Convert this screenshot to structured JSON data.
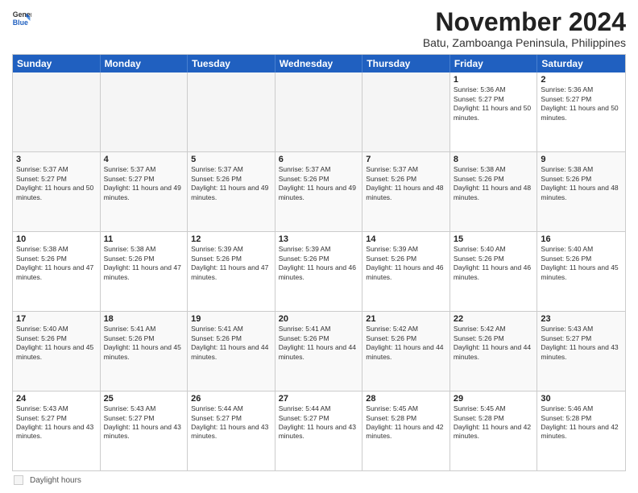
{
  "logo": {
    "general": "General",
    "blue": "Blue"
  },
  "header": {
    "month": "November 2024",
    "location": "Batu, Zamboanga Peninsula, Philippines"
  },
  "days_of_week": [
    "Sunday",
    "Monday",
    "Tuesday",
    "Wednesday",
    "Thursday",
    "Friday",
    "Saturday"
  ],
  "weeks": [
    [
      {
        "day": "",
        "text": "",
        "empty": true
      },
      {
        "day": "",
        "text": "",
        "empty": true
      },
      {
        "day": "",
        "text": "",
        "empty": true
      },
      {
        "day": "",
        "text": "",
        "empty": true
      },
      {
        "day": "",
        "text": "",
        "empty": true
      },
      {
        "day": "1",
        "text": "Sunrise: 5:36 AM\nSunset: 5:27 PM\nDaylight: 11 hours and 50 minutes.",
        "empty": false
      },
      {
        "day": "2",
        "text": "Sunrise: 5:36 AM\nSunset: 5:27 PM\nDaylight: 11 hours and 50 minutes.",
        "empty": false
      }
    ],
    [
      {
        "day": "3",
        "text": "Sunrise: 5:37 AM\nSunset: 5:27 PM\nDaylight: 11 hours and 50 minutes.",
        "empty": false
      },
      {
        "day": "4",
        "text": "Sunrise: 5:37 AM\nSunset: 5:27 PM\nDaylight: 11 hours and 49 minutes.",
        "empty": false
      },
      {
        "day": "5",
        "text": "Sunrise: 5:37 AM\nSunset: 5:26 PM\nDaylight: 11 hours and 49 minutes.",
        "empty": false
      },
      {
        "day": "6",
        "text": "Sunrise: 5:37 AM\nSunset: 5:26 PM\nDaylight: 11 hours and 49 minutes.",
        "empty": false
      },
      {
        "day": "7",
        "text": "Sunrise: 5:37 AM\nSunset: 5:26 PM\nDaylight: 11 hours and 48 minutes.",
        "empty": false
      },
      {
        "day": "8",
        "text": "Sunrise: 5:38 AM\nSunset: 5:26 PM\nDaylight: 11 hours and 48 minutes.",
        "empty": false
      },
      {
        "day": "9",
        "text": "Sunrise: 5:38 AM\nSunset: 5:26 PM\nDaylight: 11 hours and 48 minutes.",
        "empty": false
      }
    ],
    [
      {
        "day": "10",
        "text": "Sunrise: 5:38 AM\nSunset: 5:26 PM\nDaylight: 11 hours and 47 minutes.",
        "empty": false
      },
      {
        "day": "11",
        "text": "Sunrise: 5:38 AM\nSunset: 5:26 PM\nDaylight: 11 hours and 47 minutes.",
        "empty": false
      },
      {
        "day": "12",
        "text": "Sunrise: 5:39 AM\nSunset: 5:26 PM\nDaylight: 11 hours and 47 minutes.",
        "empty": false
      },
      {
        "day": "13",
        "text": "Sunrise: 5:39 AM\nSunset: 5:26 PM\nDaylight: 11 hours and 46 minutes.",
        "empty": false
      },
      {
        "day": "14",
        "text": "Sunrise: 5:39 AM\nSunset: 5:26 PM\nDaylight: 11 hours and 46 minutes.",
        "empty": false
      },
      {
        "day": "15",
        "text": "Sunrise: 5:40 AM\nSunset: 5:26 PM\nDaylight: 11 hours and 46 minutes.",
        "empty": false
      },
      {
        "day": "16",
        "text": "Sunrise: 5:40 AM\nSunset: 5:26 PM\nDaylight: 11 hours and 45 minutes.",
        "empty": false
      }
    ],
    [
      {
        "day": "17",
        "text": "Sunrise: 5:40 AM\nSunset: 5:26 PM\nDaylight: 11 hours and 45 minutes.",
        "empty": false
      },
      {
        "day": "18",
        "text": "Sunrise: 5:41 AM\nSunset: 5:26 PM\nDaylight: 11 hours and 45 minutes.",
        "empty": false
      },
      {
        "day": "19",
        "text": "Sunrise: 5:41 AM\nSunset: 5:26 PM\nDaylight: 11 hours and 44 minutes.",
        "empty": false
      },
      {
        "day": "20",
        "text": "Sunrise: 5:41 AM\nSunset: 5:26 PM\nDaylight: 11 hours and 44 minutes.",
        "empty": false
      },
      {
        "day": "21",
        "text": "Sunrise: 5:42 AM\nSunset: 5:26 PM\nDaylight: 11 hours and 44 minutes.",
        "empty": false
      },
      {
        "day": "22",
        "text": "Sunrise: 5:42 AM\nSunset: 5:26 PM\nDaylight: 11 hours and 44 minutes.",
        "empty": false
      },
      {
        "day": "23",
        "text": "Sunrise: 5:43 AM\nSunset: 5:27 PM\nDaylight: 11 hours and 43 minutes.",
        "empty": false
      }
    ],
    [
      {
        "day": "24",
        "text": "Sunrise: 5:43 AM\nSunset: 5:27 PM\nDaylight: 11 hours and 43 minutes.",
        "empty": false
      },
      {
        "day": "25",
        "text": "Sunrise: 5:43 AM\nSunset: 5:27 PM\nDaylight: 11 hours and 43 minutes.",
        "empty": false
      },
      {
        "day": "26",
        "text": "Sunrise: 5:44 AM\nSunset: 5:27 PM\nDaylight: 11 hours and 43 minutes.",
        "empty": false
      },
      {
        "day": "27",
        "text": "Sunrise: 5:44 AM\nSunset: 5:27 PM\nDaylight: 11 hours and 43 minutes.",
        "empty": false
      },
      {
        "day": "28",
        "text": "Sunrise: 5:45 AM\nSunset: 5:28 PM\nDaylight: 11 hours and 42 minutes.",
        "empty": false
      },
      {
        "day": "29",
        "text": "Sunrise: 5:45 AM\nSunset: 5:28 PM\nDaylight: 11 hours and 42 minutes.",
        "empty": false
      },
      {
        "day": "30",
        "text": "Sunrise: 5:46 AM\nSunset: 5:28 PM\nDaylight: 11 hours and 42 minutes.",
        "empty": false
      }
    ]
  ],
  "legend": {
    "label": "Daylight hours"
  }
}
